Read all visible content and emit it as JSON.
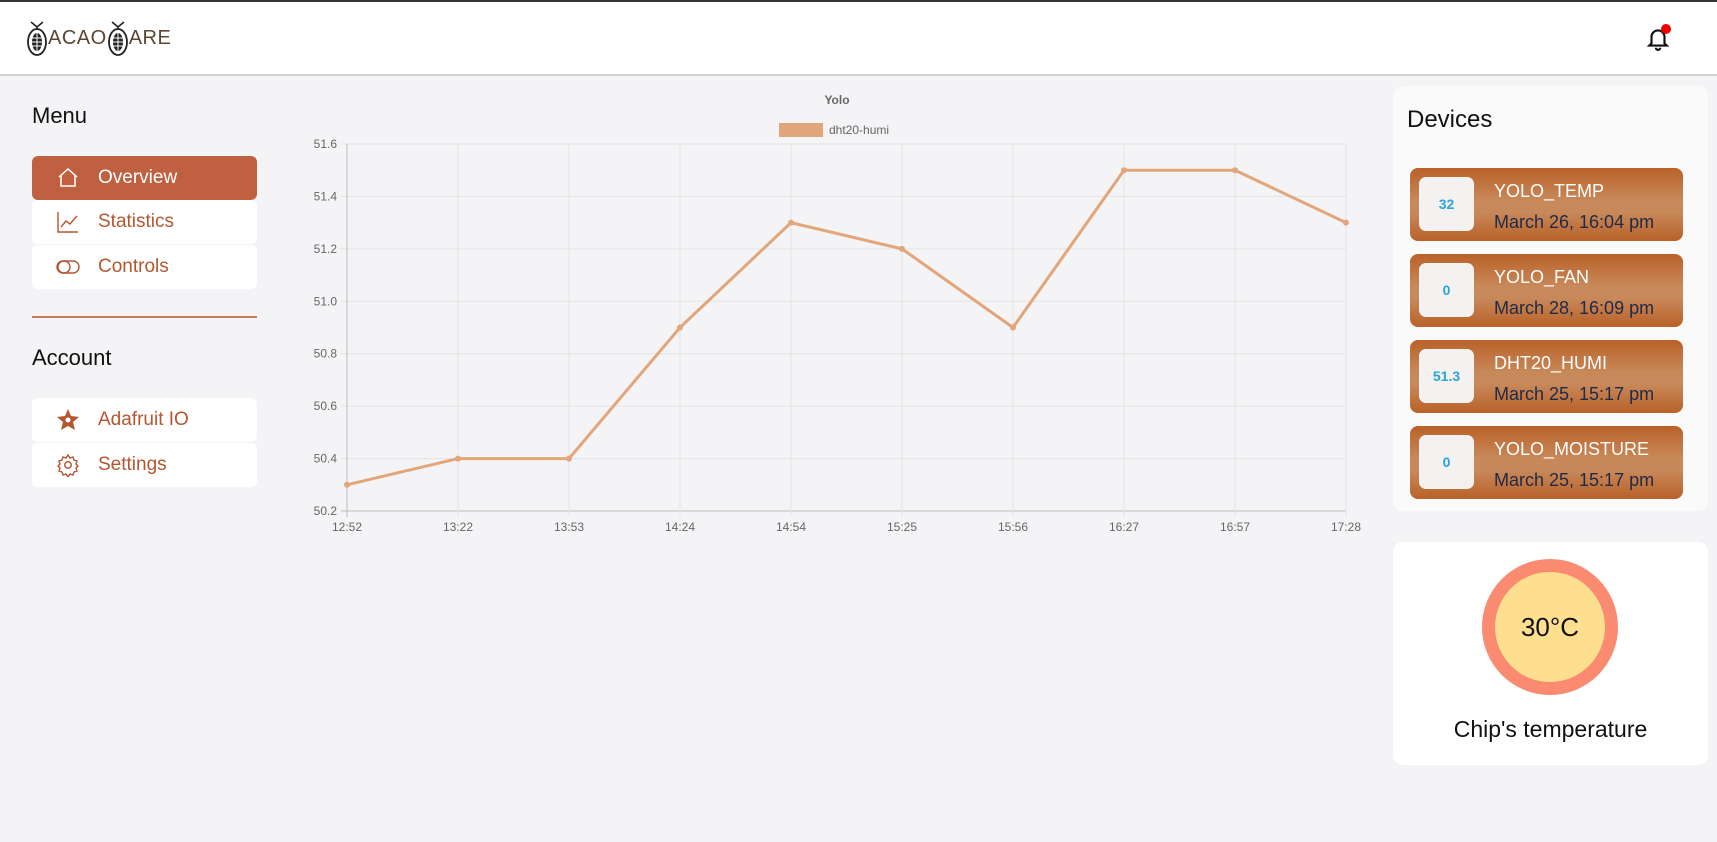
{
  "header": {
    "logo_text": [
      "ACAO",
      "ARE"
    ],
    "logo": "CacaoCare",
    "notification_icon": "bell-icon",
    "notification_dot_color": "#e00000"
  },
  "sidebar": {
    "menu_title": "Menu",
    "menu_items": [
      {
        "label": "Overview",
        "icon": "home-icon",
        "active": true
      },
      {
        "label": "Statistics",
        "icon": "line-chart-icon"
      },
      {
        "label": "Controls",
        "icon": "toggle-icon"
      }
    ],
    "account_title": "Account",
    "account_items": [
      {
        "label": "Adafruit IO",
        "icon": "adafruit-flower-icon"
      },
      {
        "label": "Settings",
        "icon": "gear-icon"
      }
    ]
  },
  "chart_data": {
    "type": "line",
    "title": "Yolo",
    "legend": "top",
    "categories": [
      "12:52",
      "13:22",
      "13:53",
      "14:24",
      "14:54",
      "15:25",
      "15:56",
      "16:27",
      "16:57",
      "17:28"
    ],
    "series": [
      {
        "name": "dht20-humi",
        "values": [
          50.3,
          50.4,
          50.4,
          50.9,
          51.3,
          51.2,
          50.9,
          51.5,
          51.5,
          51.3
        ],
        "color": "#e3a57a"
      }
    ],
    "ylim": [
      50.2,
      51.6
    ],
    "yticks": [
      "50.2",
      "50.4",
      "50.6",
      "50.8",
      "51.0",
      "51.2",
      "51.4",
      "51.6"
    ],
    "grid": true
  },
  "devices": {
    "title": "Devices",
    "items": [
      {
        "value": "32",
        "name": "YOLO_TEMP",
        "date": "March 26, 16:04 pm"
      },
      {
        "value": "0",
        "name": "YOLO_FAN",
        "date": "March 28, 16:09 pm"
      },
      {
        "value": "51.3",
        "name": "DHT20_HUMI",
        "date": "March 25, 15:17 pm"
      },
      {
        "value": "0",
        "name": "YOLO_MOISTURE",
        "date": "March 25, 15:17 pm"
      }
    ]
  },
  "temperature": {
    "value": "30°C",
    "label": "Chip's temperature",
    "ring_color": "#fa8a70",
    "fill_color": "#fddf8f"
  }
}
